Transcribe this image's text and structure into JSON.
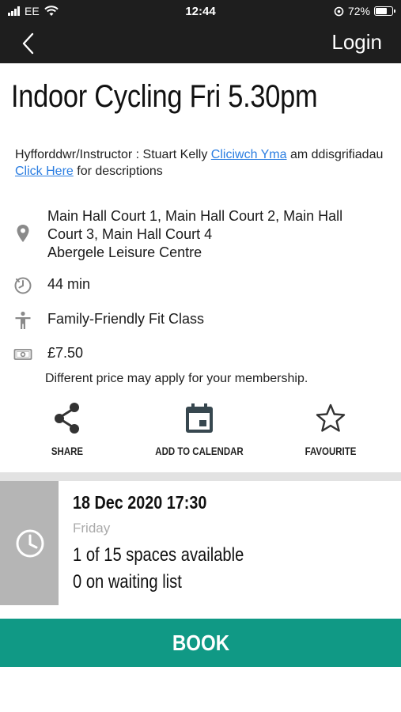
{
  "status_bar": {
    "carrier": "EE",
    "time": "12:44",
    "battery_percent": "72%",
    "battery_level": 0.72,
    "icons": [
      "signal-icon",
      "wifi-icon",
      "location-lock-icon",
      "battery-icon"
    ]
  },
  "nav": {
    "back_icon": "chevron-left-icon",
    "login_label": "Login"
  },
  "class": {
    "title": "Indoor Cycling Fri 5.30pm",
    "instructor_prefix": "Hyfforddwr/Instructor : Stuart Kelly ",
    "link_welsh": "Cliciwch Yma",
    "mid_text": " am ddisgrifiadau ",
    "link_english": "Click Here",
    "suffix_text": " for descriptions"
  },
  "details": {
    "location_line1": "Main Hall Court 1, Main Hall Court 2, Main Hall",
    "location_line2": "Court 3, Main Hall Court 4",
    "venue": "Abergele Leisure Centre",
    "duration": "44 min",
    "category": "Family-Friendly Fit Class",
    "price": "£7.50",
    "price_note": "Different price may apply for your membership."
  },
  "actions": {
    "share_label": "SHARE",
    "calendar_label": "ADD TO CALENDAR",
    "favourite_label": "FAVOURITE"
  },
  "slot": {
    "datetime": "18 Dec 2020  17:30",
    "day": "Friday",
    "spaces": "1 of 15 spaces available",
    "waiting": "0 on waiting list"
  },
  "book_label": "BOOK",
  "colors": {
    "bar_bg": "#1e1e1e",
    "link": "#2a7de1",
    "book_bg": "#109985",
    "slot_clock_bg": "#b5b5b5",
    "divider": "#e2e2e2"
  }
}
